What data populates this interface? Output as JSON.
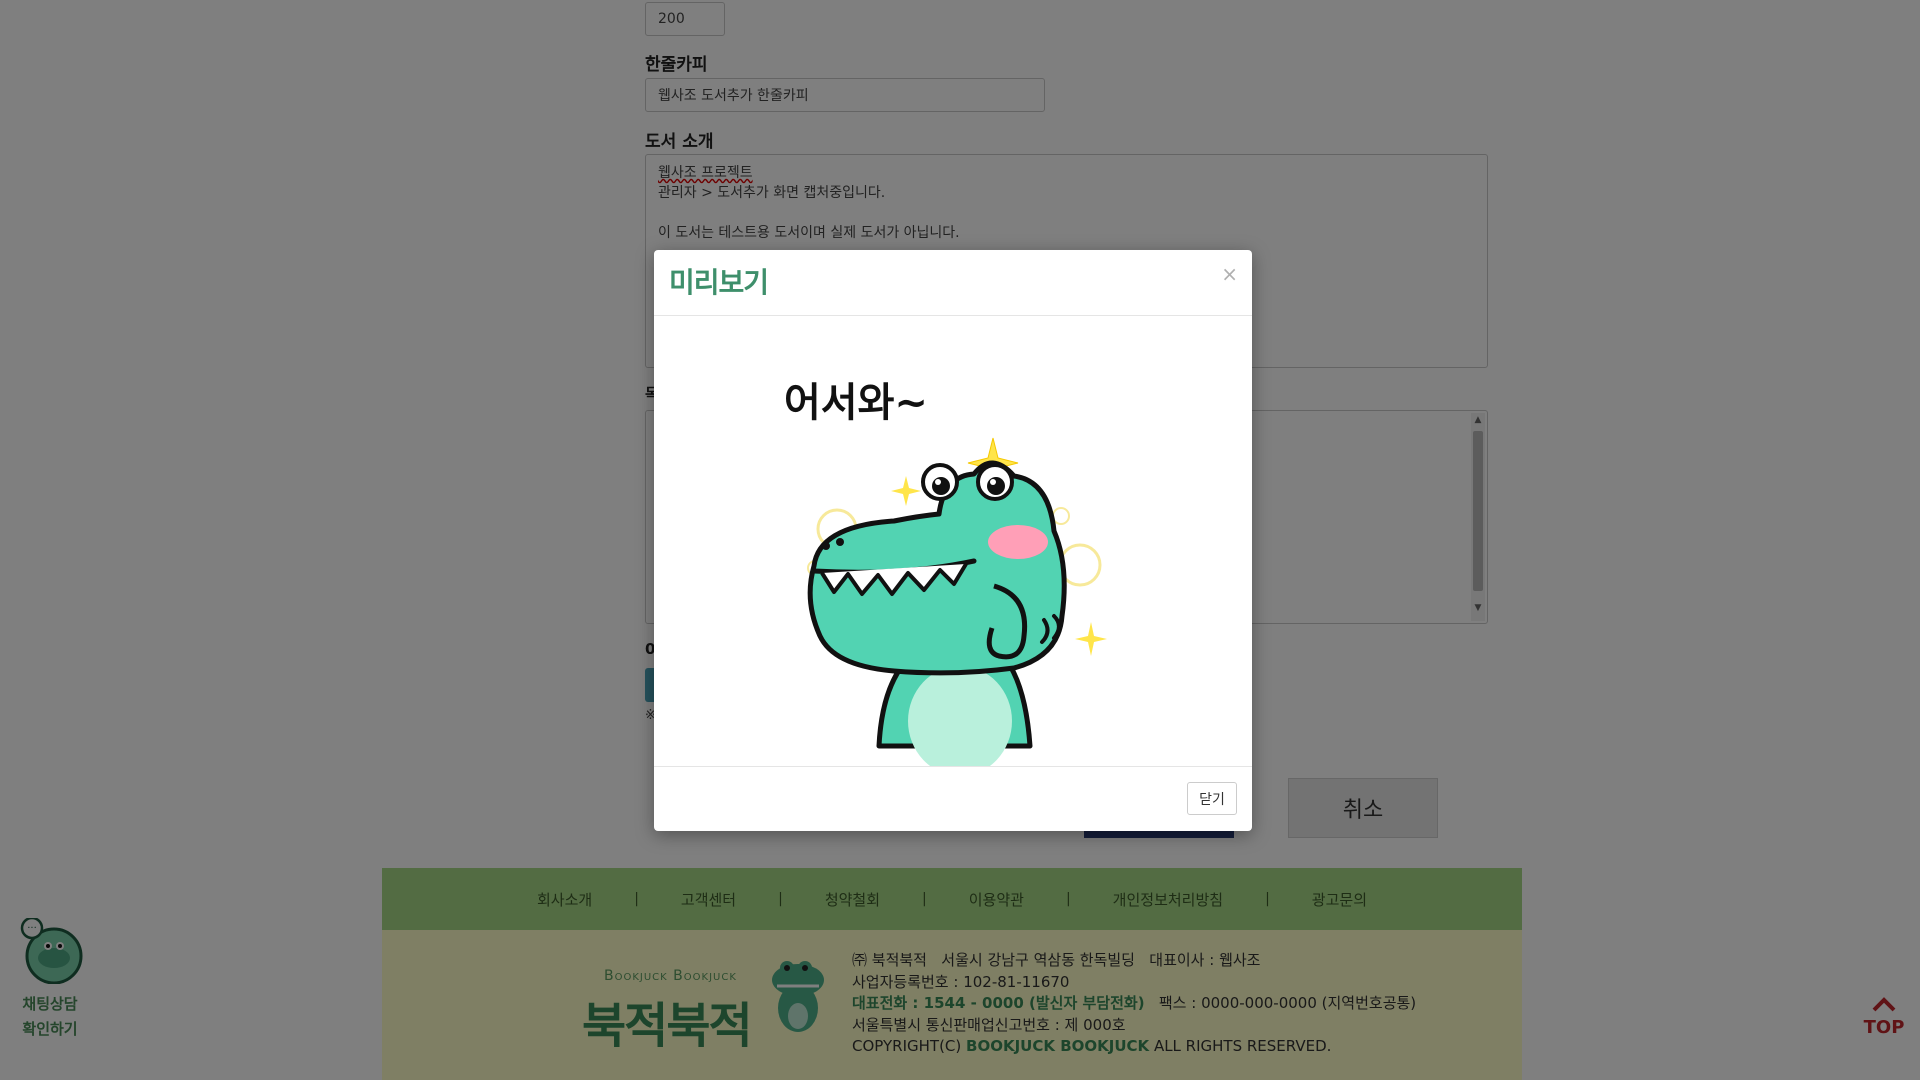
{
  "form": {
    "number_value": "200",
    "copy_label": "한줄카피",
    "copy_value": "웹사조 도서추가 한줄카피",
    "intro_label": "도서 소개",
    "intro_lines": [
      "웹사조 프로젝트",
      "관리자 > 도서추가 화면 캡처중입니다.",
      "",
      "이 도서는 테스트용 도서이며 실제 도서가 아닙니다."
    ],
    "toc_label_partial": "목",
    "file_label_partial": "0",
    "note_partial": "※",
    "cancel_label": "취소"
  },
  "modal": {
    "title": "미리보기",
    "close_symbol": "×",
    "sticker_text": "어서와~",
    "close_button_label": "닫기"
  },
  "footer": {
    "nav": [
      "회사소개",
      "고객센터",
      "청약철회",
      "이용약관",
      "개인정보처리방침",
      "광고문의"
    ],
    "separator": "|",
    "logo_en": "Bookjuck Bookjuck",
    "logo_ko": "북적북적",
    "info": {
      "line1": "㈜ 북적북적   서울시 강남구 역삼동 한독빌딩   대표이사 : 웹사조",
      "line2": "사업자등록번호 : 102-81-11670",
      "line3_highlight": "대표전화 : 1544 - 0000 (발신자 부담전화)",
      "line3_rest": "   팩스 : 0000-000-0000 (지역번호공통)",
      "line4": "서울특별시 통신판매업신고번호 : 제 000호",
      "line5_prefix": "COPYRIGHT(C) ",
      "line5_highlight": "BOOKJUCK BOOKJUCK",
      "line5_suffix": " ALL RIGHTS RESERVED."
    }
  },
  "side": {
    "chat_line1": "채팅상담",
    "chat_line2": "확인하기",
    "top_label": "TOP"
  },
  "colors": {
    "accent_green": "#3e8f6b",
    "footer_nav_bg": "#a6d886",
    "footer_info_bg": "#fefec8",
    "top_red": "#c1272d",
    "croc_body": "#52d3b2"
  }
}
